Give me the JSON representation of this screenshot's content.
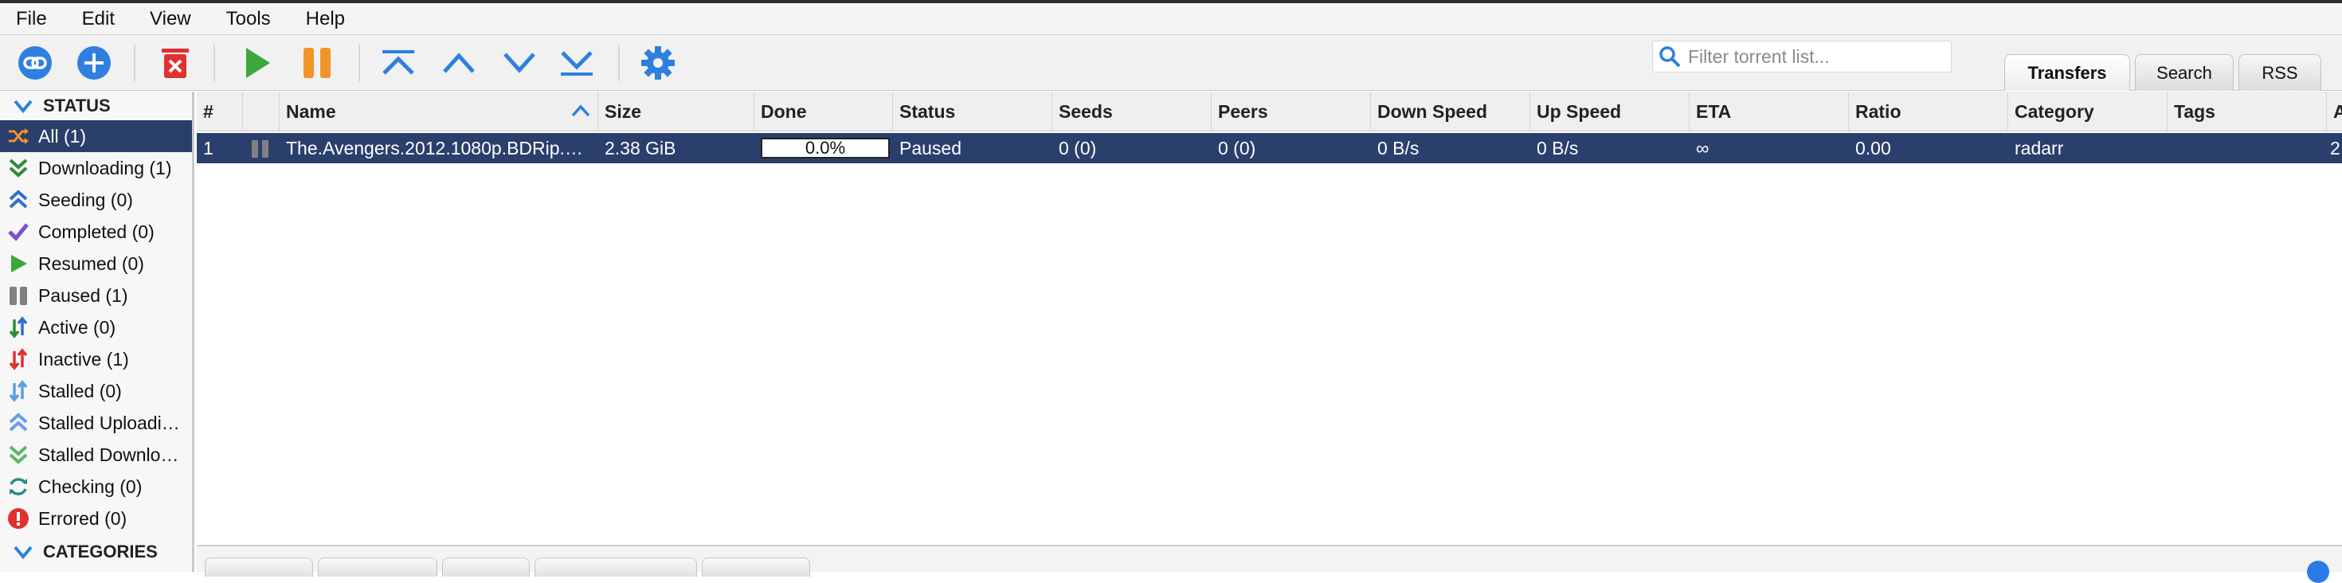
{
  "menu": [
    "File",
    "Edit",
    "View",
    "Tools",
    "Help"
  ],
  "toolbar": {
    "buttons": [
      {
        "name": "add-torrent-link-button",
        "icon": "link-icon"
      },
      {
        "name": "add-torrent-file-button",
        "icon": "plus-circle-icon"
      },
      {
        "name": "delete-button",
        "icon": "trash-delete-icon"
      },
      {
        "name": "resume-button",
        "icon": "play-icon"
      },
      {
        "name": "pause-button",
        "icon": "pause-icon"
      },
      {
        "name": "move-top-button",
        "icon": "chevron-top-icon"
      },
      {
        "name": "move-up-button",
        "icon": "chevron-up-icon"
      },
      {
        "name": "move-down-button",
        "icon": "chevron-down-icon"
      },
      {
        "name": "move-bottom-button",
        "icon": "chevron-bottom-icon"
      },
      {
        "name": "options-button",
        "icon": "gear-icon"
      }
    ],
    "filter_placeholder": "Filter torrent list...",
    "tabs": [
      "Transfers",
      "Search",
      "RSS"
    ]
  },
  "sidebar": {
    "status_header": "STATUS",
    "items": [
      {
        "label": "All (1)",
        "icon": "shuffle-icon",
        "selected": true
      },
      {
        "label": "Downloading (1)",
        "icon": "double-chevron-down-icon"
      },
      {
        "label": "Seeding (0)",
        "icon": "double-chevron-up-icon"
      },
      {
        "label": "Completed (0)",
        "icon": "checkmark-icon"
      },
      {
        "label": "Resumed (0)",
        "icon": "play-icon"
      },
      {
        "label": "Paused (1)",
        "icon": "pause-icon"
      },
      {
        "label": "Active (0)",
        "icon": "up-down-arrows-icon"
      },
      {
        "label": "Inactive (1)",
        "icon": "up-down-arrows-red-icon"
      },
      {
        "label": "Stalled (0)",
        "icon": "up-down-arrows-blue-icon"
      },
      {
        "label": "Stalled Uploadi…",
        "icon": "double-chevron-up-light-icon"
      },
      {
        "label": "Stalled Downlo…",
        "icon": "double-chevron-down-light-icon"
      },
      {
        "label": "Checking (0)",
        "icon": "refresh-icon"
      },
      {
        "label": "Errored (0)",
        "icon": "error-icon"
      }
    ],
    "categories_header": "CATEGORIES"
  },
  "table": {
    "columns": [
      "#",
      "",
      "Name",
      "Size",
      "Done",
      "Status",
      "Seeds",
      "Peers",
      "Down Speed",
      "Up Speed",
      "ETA",
      "Ratio",
      "Category",
      "Tags",
      "A"
    ],
    "sort_column": "Name",
    "rows": [
      {
        "num": "1",
        "name": "The.Avengers.2012.1080p.BDRip.…",
        "size": "2.38 GiB",
        "done": "0.0%",
        "done_fraction": 0.0,
        "status": "Paused",
        "seeds": "0 (0)",
        "peers": "0 (0)",
        "down_speed": "0 B/s",
        "up_speed": "0 B/s",
        "eta": "∞",
        "ratio": "0.00",
        "category": "radarr",
        "tags": "",
        "added": "2"
      }
    ]
  },
  "colors": {
    "selection": "#2b3f6c",
    "toolbar_blue": "#2f7fe0",
    "play_green": "#3aa83a",
    "pause_orange": "#f0952a",
    "delete_red": "#e03030"
  }
}
